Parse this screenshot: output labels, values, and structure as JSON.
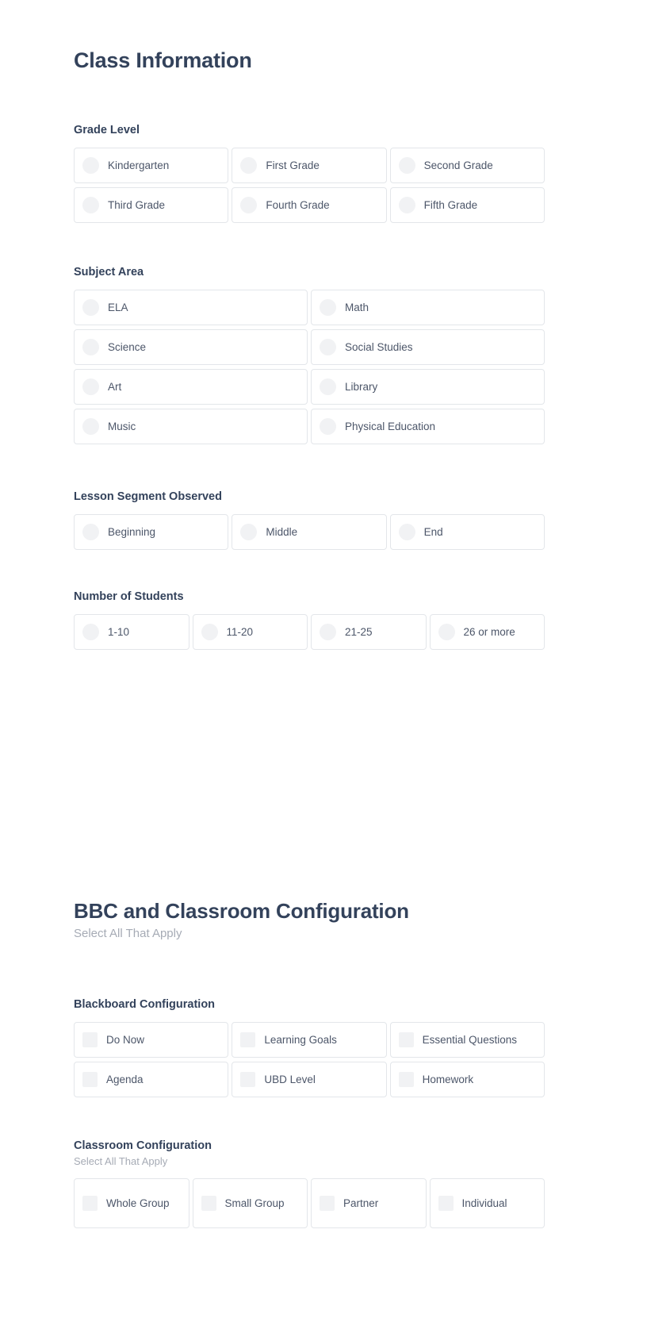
{
  "page": {
    "title": "Class Information"
  },
  "groups": {
    "grade_level": {
      "label": "Grade Level",
      "options": [
        "Kindergarten",
        "First Grade",
        "Second Grade",
        "Third Grade",
        "Fourth Grade",
        "Fifth Grade"
      ]
    },
    "subject_area": {
      "label": "Subject Area",
      "options": [
        "ELA",
        "Math",
        "Science",
        "Social Studies",
        "Art",
        "Library",
        "Music",
        "Physical Education"
      ]
    },
    "lesson_segment": {
      "label": "Lesson Segment Observed",
      "options": [
        "Beginning",
        "Middle",
        "End"
      ]
    },
    "number_of_students": {
      "label": "Number of Students",
      "options": [
        "1-10",
        "11-20",
        "21-25",
        "26 or more"
      ]
    }
  },
  "bbc_section": {
    "title": "BBC and Classroom Configuration",
    "subtitle": "Select All That Apply",
    "blackboard_configuration": {
      "label": "Blackboard Configuration",
      "options": [
        "Do Now",
        "Learning Goals",
        "Essential Questions",
        "Agenda",
        "UBD Level",
        "Homework"
      ]
    },
    "classroom_configuration": {
      "label": "Classroom Configuration",
      "sublabel": "Select All That Apply",
      "options": [
        "Whole Group",
        "Small Group",
        "Partner",
        "Individual"
      ]
    }
  },
  "colors": {
    "heading": "#33425b",
    "label": "#4c5669",
    "muted": "#a6abb5",
    "border": "#e3e6ea",
    "control": "#f1f2f4"
  }
}
